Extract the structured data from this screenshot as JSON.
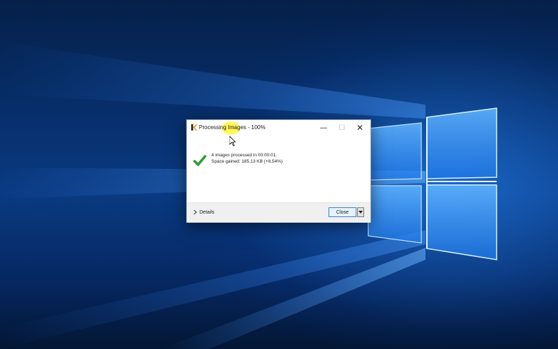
{
  "dialog": {
    "title": "Processing Images - 100%",
    "window_buttons": {
      "minimize": "—",
      "maximize": "☐",
      "close": "✕"
    },
    "message_line1": "4 images processed in 00:00:01.",
    "message_line2": "Space gained: 185,13 KB (+8,54%)",
    "details_label": "Details",
    "close_label": "Close"
  },
  "icons": {
    "app": "app-icon",
    "status": "checkmark-icon",
    "details": "chevron-right-icon",
    "split": "dropdown-arrow-icon",
    "pointer": "mouse-cursor-icon"
  },
  "colors": {
    "checkmark": "#2e9e2e",
    "highlight": "#fff53c",
    "desktop_blue": "#0a3a82",
    "close_button_border": "#3c7fd1"
  }
}
